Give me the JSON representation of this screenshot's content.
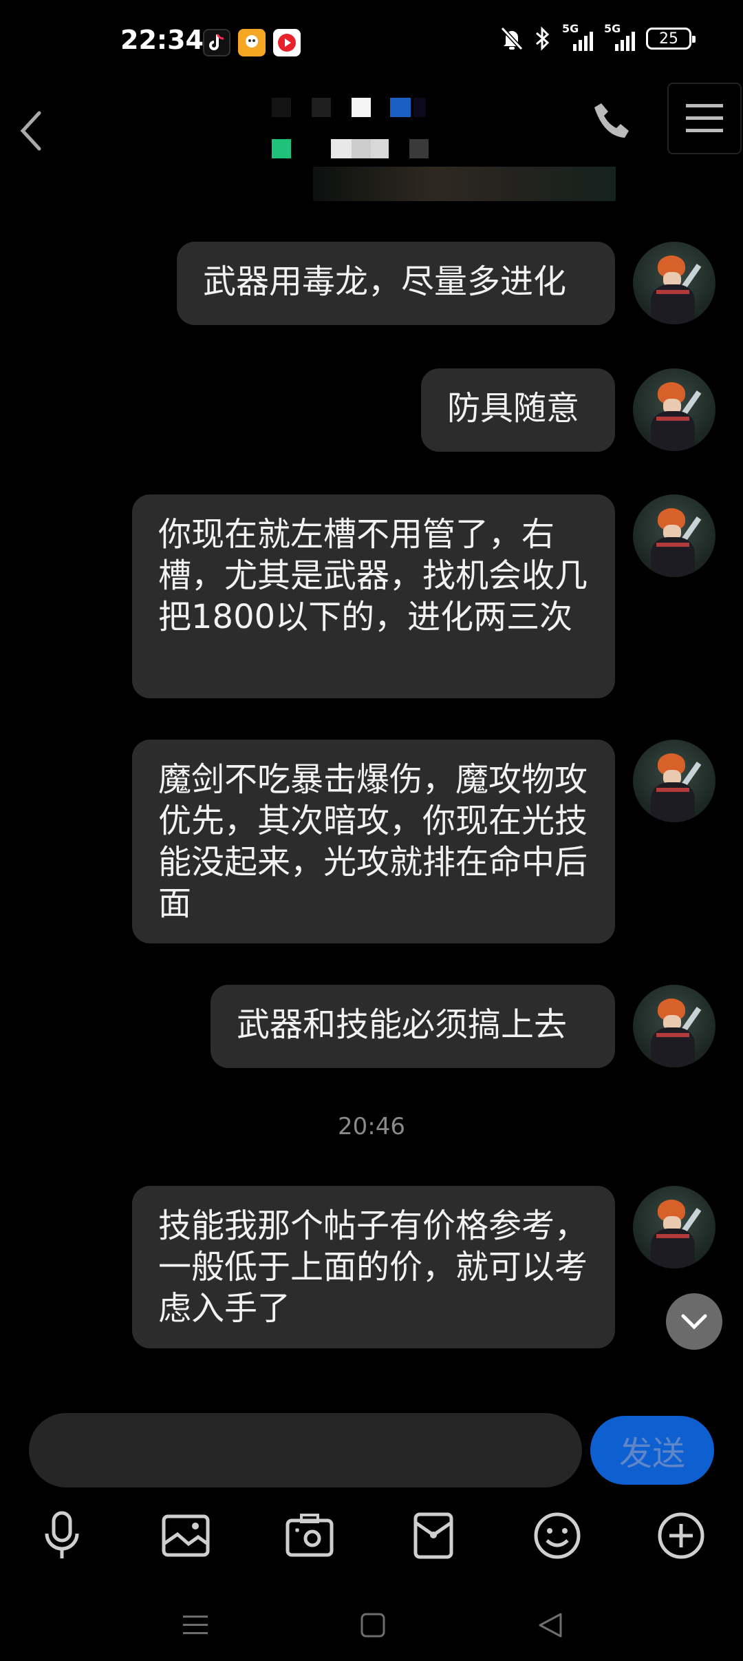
{
  "status_bar": {
    "time": "22:34",
    "battery": "25",
    "signal_1_label": "5G",
    "signal_2_label": "5G"
  },
  "messages": [
    {
      "text": "武器用毒龙，尽量多进化"
    },
    {
      "text": "防具随意"
    },
    {
      "text": "你现在就左槽不用管了，右槽，尤其是武器，找机会收几把1800以下的，进化两三次"
    },
    {
      "text": "魔剑不吃暴击爆伤，魔攻物攻优先，其次暗攻，你现在光技能没起来，光攻就排在命中后面"
    },
    {
      "text": "武器和技能必须搞上去"
    },
    {
      "timestamp": "20:46"
    },
    {
      "text": "技能我那个帖子有价格参考，一般低于上面的价，就可以考虑入手了"
    }
  ],
  "composer": {
    "input_value": "",
    "send_label": "发送"
  },
  "toolbar": {
    "icons": [
      "microphone-icon",
      "image-icon",
      "camera-icon",
      "red-packet-icon",
      "emoji-icon",
      "plus-icon"
    ]
  },
  "nav": {
    "icons": [
      "menu-icon",
      "home-icon",
      "back-icon"
    ]
  },
  "colors": {
    "background": "#000000",
    "bubble": "#2c2c2c",
    "send_button": "#0e5fcf",
    "send_text": "#5f86c8",
    "timestamp": "#8a8a8a"
  }
}
